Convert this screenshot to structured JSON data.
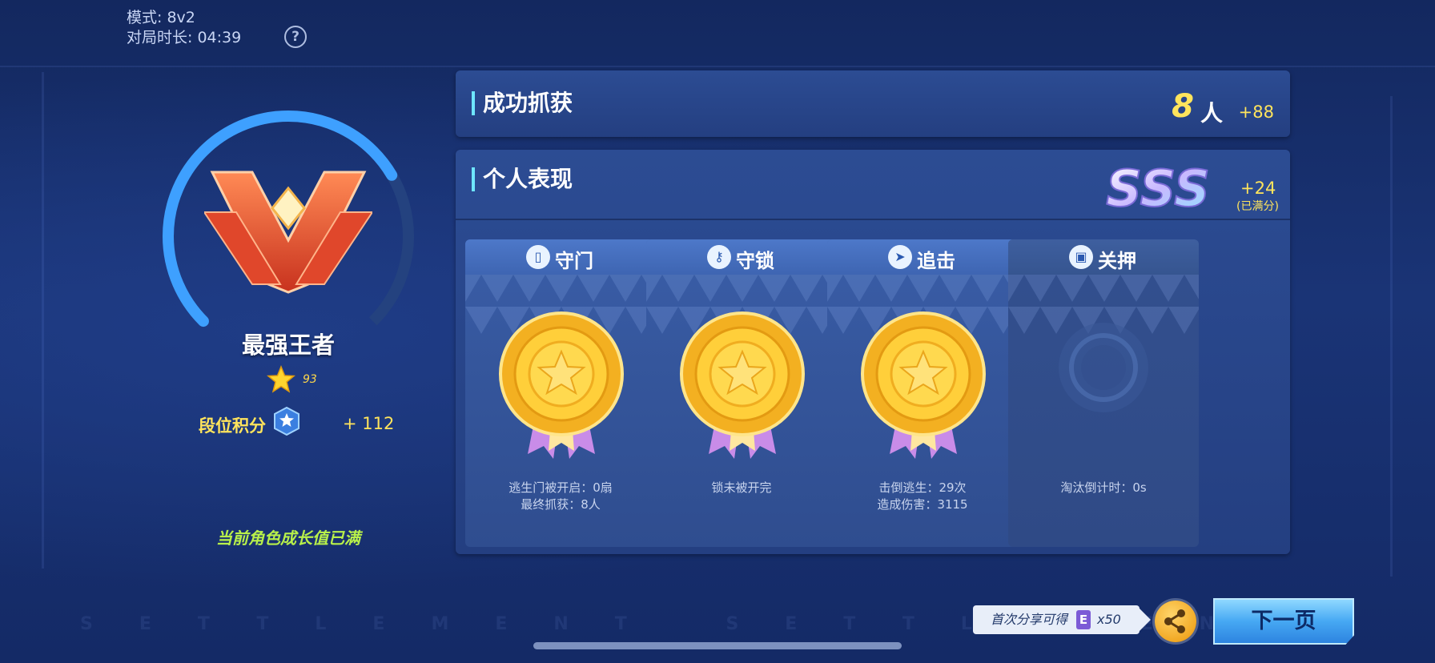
{
  "match_info": {
    "mode": "模式: 8v2",
    "duration": "对局时长: 04:39",
    "help": "?"
  },
  "rank": {
    "title": "最强王者",
    "stars": "93",
    "points_label": "段位积分",
    "points_delta": "+ 112",
    "ring_progress": 0.72,
    "growth_note": "当前角色成长值已满"
  },
  "capture": {
    "title": "成功抓获",
    "count": "8",
    "unit": "人",
    "bonus": "+88"
  },
  "performance": {
    "title": "个人表现",
    "grade": "SSS",
    "bonus": "+24",
    "bonus_note": "(已满分)",
    "cards": [
      {
        "title": "守门",
        "icon": "door-icon",
        "glyph": "▯",
        "medal": "gold",
        "stats": [
          "逃生门被开启：0扇",
          "最终抓获：8人"
        ]
      },
      {
        "title": "守锁",
        "icon": "key-icon",
        "glyph": "⚷",
        "medal": "gold",
        "stats": [
          "锁未被开完"
        ]
      },
      {
        "title": "追击",
        "icon": "chase-icon",
        "glyph": "➤",
        "medal": "gold",
        "stats": [
          "击倒逃生：29次",
          "造成伤害：3115"
        ]
      },
      {
        "title": "关押",
        "icon": "prison-icon",
        "glyph": "▣",
        "medal": "none",
        "stats": [
          "淘汰倒计时：0s"
        ]
      }
    ]
  },
  "share": {
    "tip": "首次分享可得",
    "coupon_icon": "E",
    "coupon_count": "x50"
  },
  "next_button": "下一页",
  "colors": {
    "accent_yellow": "#ffe45c",
    "accent_green": "#b8f04a",
    "ring_blue": "#3ea0ff",
    "panel": "#2c4c93"
  }
}
